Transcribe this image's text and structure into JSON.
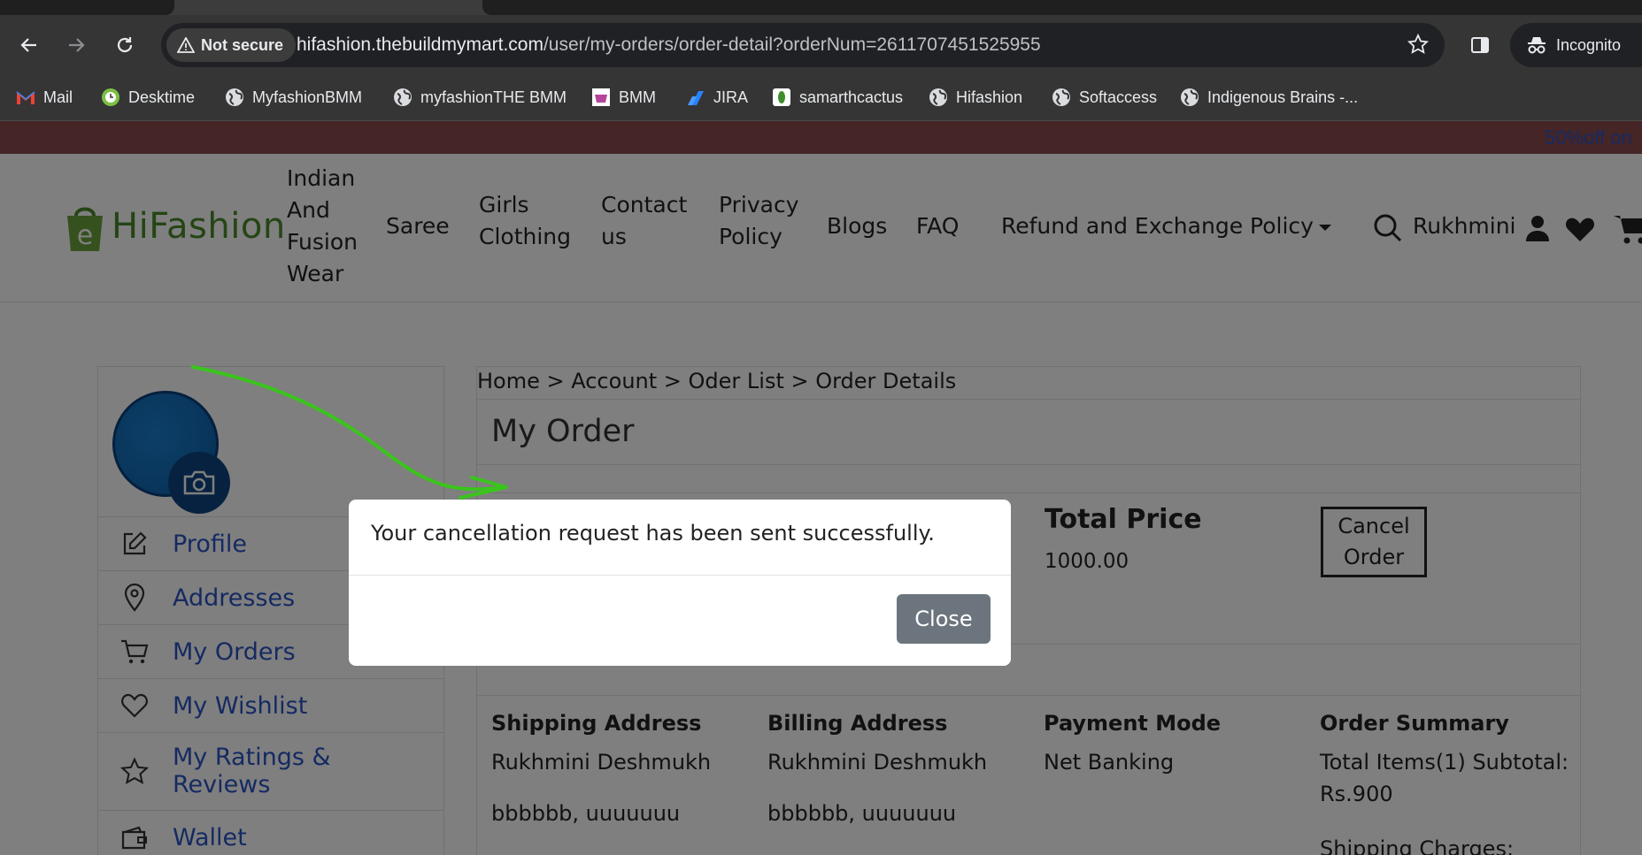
{
  "browser": {
    "security_label": "Not secure",
    "url_host": "hifashion.thebuildmymart.com",
    "url_path": "/user/my-orders/order-detail?orderNum=2611707451525955",
    "incognito_label": "Incognito",
    "bookmarks": [
      {
        "label": "Mail",
        "icon": "gmail-icon"
      },
      {
        "label": "Desktime",
        "icon": "desktime-icon"
      },
      {
        "label": "MyfashionBMM",
        "icon": "globe-icon"
      },
      {
        "label": "myfashionTHE BMM",
        "icon": "globe-icon"
      },
      {
        "label": "BMM",
        "icon": "bmm-icon"
      },
      {
        "label": "JIRA",
        "icon": "jira-icon"
      },
      {
        "label": "samarthcactus",
        "icon": "cactus-icon"
      },
      {
        "label": "Hifashion",
        "icon": "globe-icon"
      },
      {
        "label": "Softaccess",
        "icon": "globe-icon"
      },
      {
        "label": "Indigenous Brains -...",
        "icon": "globe-icon"
      }
    ]
  },
  "promo": {
    "text": "50%off on"
  },
  "header": {
    "logo_text": "HiFashion",
    "nav": {
      "indian_l1": "Indian",
      "indian_l2": "And",
      "indian_l3": "Fusion",
      "indian_l4": "Wear",
      "saree": "Saree",
      "girls_l1": "Girls",
      "girls_l2": "Clothing",
      "contact_l1": "Contact",
      "contact_l2": "us",
      "privacy_l1": "Privacy",
      "privacy_l2": "Policy",
      "blogs": "Blogs",
      "faq": "FAQ",
      "refund": "Refund and Exchange Policy"
    },
    "user_name": "Rukhmini"
  },
  "sidebar": {
    "items": [
      {
        "label": "Profile",
        "icon": "edit-icon"
      },
      {
        "label": "Addresses",
        "icon": "location-pin-icon"
      },
      {
        "label": "My Orders",
        "icon": "cart-icon"
      },
      {
        "label": "My Wishlist",
        "icon": "heart-icon"
      },
      {
        "label_l1": "My Ratings &",
        "label_l2": "Reviews",
        "icon": "star-icon"
      },
      {
        "label": "Wallet",
        "icon": "wallet-icon"
      }
    ]
  },
  "main": {
    "breadcrumb": "Home > Account > Oder List > Order Details",
    "title": "My Order",
    "total_price_label": "Total Price",
    "total_price_value": "1000.00",
    "cancel_l1": "Cancel",
    "cancel_l2": "Order",
    "shipping": {
      "heading": "Shipping Address",
      "name": "Rukhmini Deshmukh",
      "address": "bbbbbb, uuuuuuu"
    },
    "billing": {
      "heading": "Billing Address",
      "name": "Rukhmini Deshmukh",
      "address": "bbbbbb, uuuuuuu"
    },
    "payment": {
      "heading": "Payment Mode",
      "value": "Net Banking"
    },
    "summary": {
      "heading": "Order Summary",
      "line1": "Total Items(1) Subtotal:",
      "line2": "Rs.900",
      "line3": "Shipping Charges:"
    }
  },
  "modal": {
    "message": "Your cancellation request has been sent successfully.",
    "close_label": "Close"
  },
  "colors": {
    "accent_link": "#2b55c4",
    "logo_green": "#4a8a2a",
    "close_button": "#6c757d",
    "promo_bar": "#8b4a4a"
  }
}
